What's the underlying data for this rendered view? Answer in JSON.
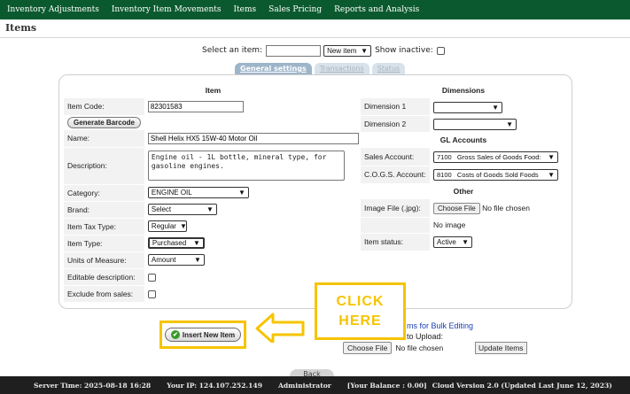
{
  "nav": {
    "items": [
      "Inventory Adjustments",
      "Inventory Item Movements",
      "Items",
      "Sales Pricing",
      "Reports and Analysis"
    ]
  },
  "page": {
    "title": "Items"
  },
  "selector": {
    "label": "Select an item:",
    "item_value": "",
    "new_item": "New item",
    "show_inactive_label": "Show inactive:"
  },
  "tabs": [
    {
      "label": "General settings",
      "active": true
    },
    {
      "label": "Transactions",
      "active": false
    },
    {
      "label": "Status",
      "active": false
    }
  ],
  "item_section": {
    "header": "Item",
    "item_code_label": "Item Code:",
    "item_code_value": "82301583",
    "generate_barcode": "Generate Barcode",
    "name_label": "Name:",
    "name_value": "Shell Helix HX5 15W-40 Motor Oil",
    "description_label": "Description:",
    "description_value": "Engine oil - 1L bottle, mineral type, for gasoline engines.",
    "category_label": "Category:",
    "category_value": "ENGINE OIL",
    "brand_label": "Brand:",
    "brand_value": "Select",
    "tax_type_label": "Item Tax Type:",
    "tax_type_value": "Regular",
    "item_type_label": "Item Type:",
    "item_type_value": "Purchased",
    "uom_label": "Units of Measure:",
    "uom_value": "Amount",
    "editable_desc_label": "Editable description:",
    "exclude_sales_label": "Exclude from sales:"
  },
  "dimensions": {
    "header": "Dimensions",
    "dim1_label": "Dimension 1",
    "dim1_value": "",
    "dim2_label": "Dimension 2",
    "dim2_value": ""
  },
  "gl_accounts": {
    "header": "GL Accounts",
    "sales_label": "Sales Account:",
    "sales_value": "7100   Gross Sales of Goods Food:",
    "cogs_label": "C.O.G.S. Account:",
    "cogs_value": "8100   Costs of Goods Sold Foods"
  },
  "other": {
    "header": "Other",
    "image_label": "Image File (.jpg):",
    "choose_file": "Choose File",
    "no_file": "No file chosen",
    "no_image": "No image",
    "status_label": "Item status:",
    "status_value": "Active"
  },
  "callout": {
    "line1": "CLICK",
    "line2": "HERE"
  },
  "actions": {
    "insert_item": "Insert New Item",
    "bulk_link": "ms for Bulk Editing",
    "to_upload": "to Upload:",
    "choose_file": "Choose File",
    "no_file": "No file chosen",
    "update_items": "Update Items",
    "back": "Back"
  },
  "footer": {
    "server_time": "Server Time: 2025-08-18 16:28",
    "ip": "Your IP: 124.107.252.149",
    "user": "Administrator",
    "balance": "[Your Balance : 0.00]",
    "version": "Cloud Version 2.0 (Updated Last June 12, 2023)"
  },
  "colors": {
    "nav_bg": "#0b5a2f",
    "footer_bg": "#1f1f1f",
    "highlight": "#f5c400",
    "tab_active": "#9db5c9",
    "link": "#1a3fb5"
  }
}
